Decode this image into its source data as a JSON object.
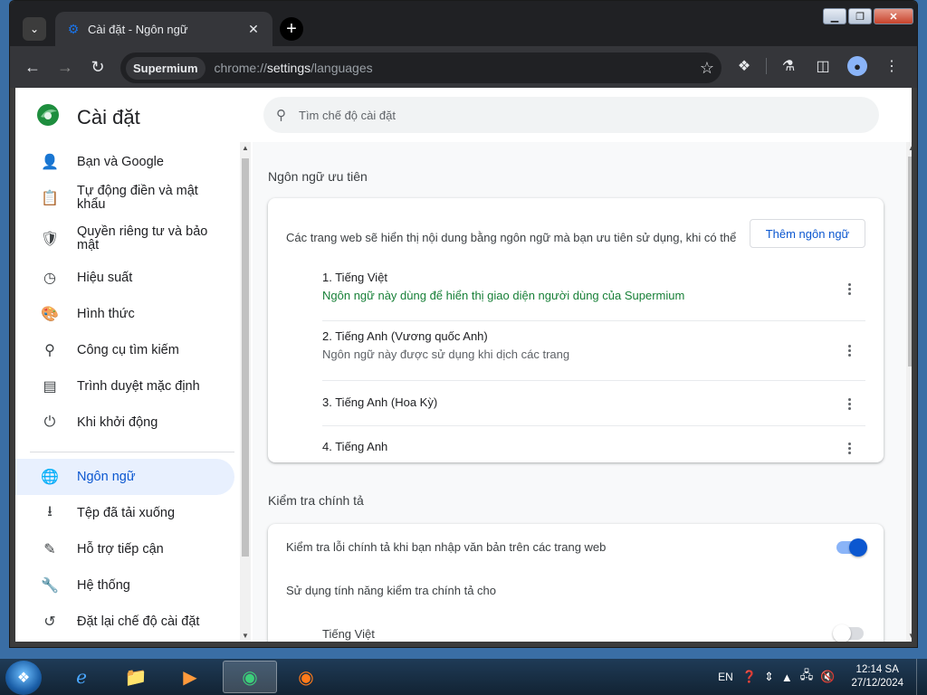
{
  "browser": {
    "tab_title": "Cài đặt - Ngôn ngữ",
    "tab_close": "✕",
    "new_tab": "+",
    "origin_chip": "Supermium",
    "url_scheme": "chrome://",
    "url_host": "settings",
    "url_path": "/languages",
    "window_controls": {
      "minimize": "▁",
      "maximize": "❐",
      "close": "✕"
    }
  },
  "header": {
    "title": "Cài đặt",
    "search_placeholder": "Tìm chế độ cài đặt"
  },
  "sidebar": {
    "items": [
      {
        "label": "Bạn và Google",
        "icon": "person-icon"
      },
      {
        "label": "Tự động điền và mật khẩu",
        "icon": "clipboard-icon"
      },
      {
        "label": "Quyền riêng tư và bảo mật",
        "icon": "shield-icon"
      },
      {
        "label": "Hiệu suất",
        "icon": "speedometer-icon"
      },
      {
        "label": "Hình thức",
        "icon": "palette-icon"
      },
      {
        "label": "Công cụ tìm kiếm",
        "icon": "search-icon"
      },
      {
        "label": "Trình duyệt mặc định",
        "icon": "browser-window-icon"
      },
      {
        "label": "Khi khởi động",
        "icon": "power-icon"
      },
      {
        "label": "Ngôn ngữ",
        "icon": "globe-icon",
        "active": true
      },
      {
        "label": "Tệp đã tải xuống",
        "icon": "download-icon"
      },
      {
        "label": "Hỗ trợ tiếp cận",
        "icon": "accessibility-icon"
      },
      {
        "label": "Hệ thống",
        "icon": "wrench-icon"
      },
      {
        "label": "Đặt lại chế độ cài đặt",
        "icon": "history-icon"
      }
    ]
  },
  "languages": {
    "section_title": "Ngôn ngữ ưu tiên",
    "description": "Các trang web sẽ hiển thị nội dung bằng ngôn ngữ mà bạn ưu tiên sử dụng, khi có thể",
    "add_button": "Thêm ngôn ngữ",
    "list": [
      {
        "name": "1. Tiếng Việt",
        "sub": "Ngôn ngữ này dùng để hiển thị giao diện người dùng của Supermium"
      },
      {
        "name": "2. Tiếng Anh (Vương quốc Anh)",
        "sub": "Ngôn ngữ này được sử dụng khi dịch các trang"
      },
      {
        "name": "3. Tiếng Anh (Hoa Kỳ)",
        "sub": ""
      },
      {
        "name": "4. Tiếng Anh",
        "sub": ""
      }
    ]
  },
  "spellcheck": {
    "section_title": "Kiểm tra chính tả",
    "check_label": "Kiểm tra lỗi chính tả khi bạn nhập văn bản trên các trang web",
    "check_on": true,
    "use_for_label": "Sử dụng tính năng kiểm tra chính tả cho",
    "lang_vi": "Tiếng Việt",
    "lang_vi_on": false
  },
  "taskbar": {
    "lang": "EN",
    "time": "12:14 SA",
    "date": "27/12/2024"
  },
  "colors": {
    "accent": "#0b57d0",
    "green_text": "#188038"
  }
}
